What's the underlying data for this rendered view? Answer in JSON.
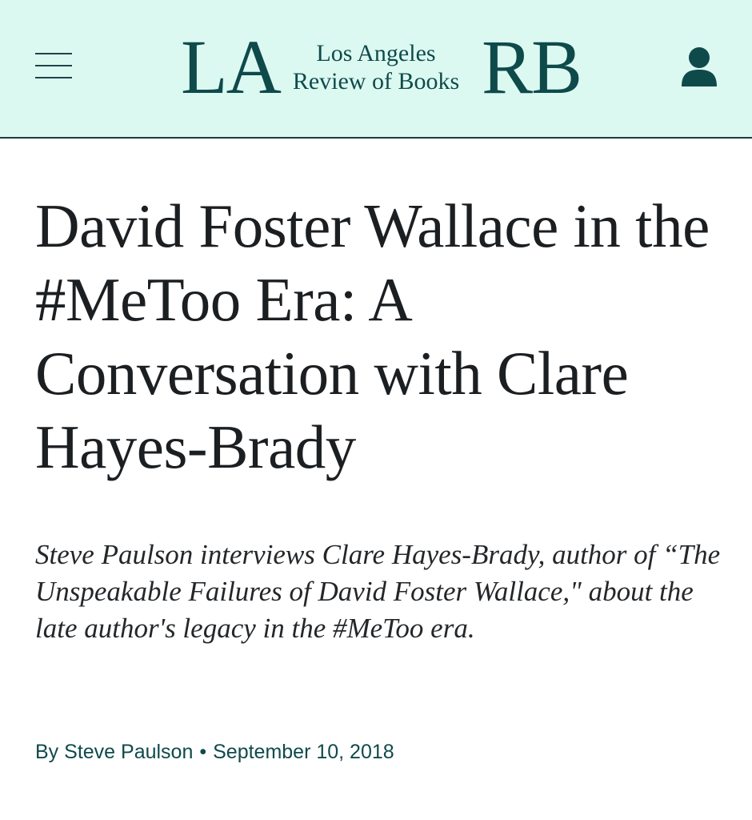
{
  "header": {
    "logo": {
      "left": "LA",
      "line1": "Los Angeles",
      "line2": "Review of Books",
      "right": "RB"
    },
    "menu_icon": "hamburger-menu-icon",
    "account_icon": "user-account-icon",
    "background_color": "#dcf9f1",
    "brand_color": "#0f4a4b"
  },
  "article": {
    "title": "David Foster Wallace in the #MeToo Era: A Conversation with Clare Hayes-Brady",
    "dek": "Steve Paulson interviews Clare Hayes-Brady, author of “The Unspeakable Failures of David Foster Wallace,\" about the late author's legacy in the #MeToo era.",
    "byline": {
      "prefix": "By",
      "author": "Steve Paulson",
      "separator": "•",
      "date": "September 10, 2018"
    }
  }
}
